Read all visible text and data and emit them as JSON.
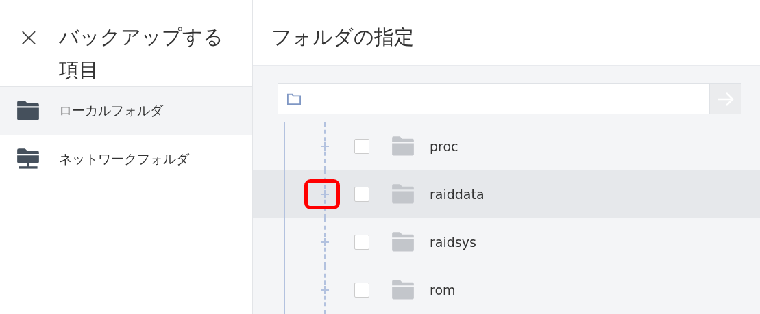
{
  "sidebar": {
    "close_label": "×",
    "title": "バックアップする項目",
    "items": [
      {
        "label": "ローカルフォルダ",
        "kind": "local",
        "selected": true
      },
      {
        "label": "ネットワークフォルダ",
        "kind": "network",
        "selected": false
      }
    ]
  },
  "main": {
    "title": "フォルダの指定",
    "tree": [
      {
        "name": "proc",
        "checked": false,
        "expanded": false,
        "selected": false,
        "annotated": false
      },
      {
        "name": "raiddata",
        "checked": false,
        "expanded": false,
        "selected": true,
        "annotated": true
      },
      {
        "name": "raidsys",
        "checked": false,
        "expanded": false,
        "selected": false,
        "annotated": false
      },
      {
        "name": "rom",
        "checked": false,
        "expanded": false,
        "selected": false,
        "annotated": false
      }
    ]
  }
}
